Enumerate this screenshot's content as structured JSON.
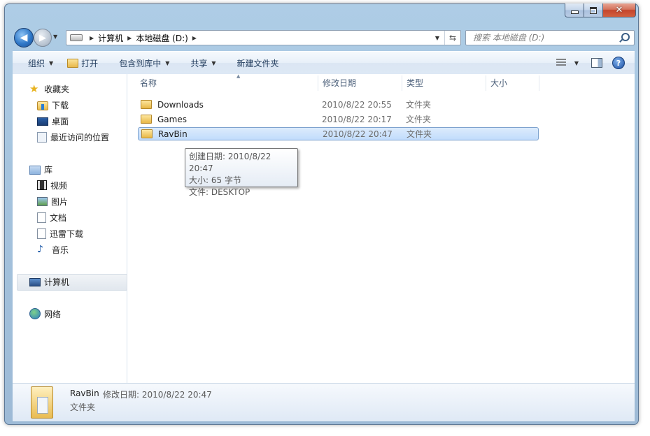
{
  "address_bar": {
    "crumbs": [
      "计算机",
      "本地磁盘 (D:)"
    ]
  },
  "search": {
    "placeholder": "搜索 本地磁盘 (D:)"
  },
  "toolbar": {
    "organize": "组织",
    "open": "打开",
    "include_in_library": "包含到库中",
    "share": "共享",
    "new_folder": "新建文件夹"
  },
  "navigation": {
    "favorites": "收藏夹",
    "downloads": "下载",
    "desktop": "桌面",
    "recent": "最近访问的位置",
    "libraries": "库",
    "videos": "视频",
    "pictures": "图片",
    "documents": "文档",
    "thunder": "迅雷下载",
    "music": "音乐",
    "computer": "计算机",
    "network": "网络"
  },
  "columns": {
    "name": "名称",
    "modified": "修改日期",
    "type": "类型",
    "size": "大小"
  },
  "files": [
    {
      "name": "Downloads",
      "modified": "2010/8/22 20:55",
      "type": "文件夹"
    },
    {
      "name": "Games",
      "modified": "2010/8/22 20:17",
      "type": "文件夹"
    },
    {
      "name": "RavBin",
      "modified": "2010/8/22 20:47",
      "type": "文件夹"
    }
  ],
  "tooltip": {
    "created": "创建日期: 2010/8/22 20:47",
    "size": "大小: 65 字节",
    "files": "文件: DESKTOP"
  },
  "details": {
    "name": "RavBin",
    "modified": "修改日期: 2010/8/22 20:47",
    "type": "文件夹"
  }
}
